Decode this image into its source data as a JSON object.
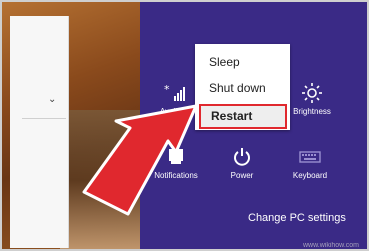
{
  "power_menu": {
    "items": [
      {
        "label": "Sleep"
      },
      {
        "label": "Shut down"
      },
      {
        "label": "Restart"
      }
    ]
  },
  "settings_tiles": [
    {
      "label": "Available",
      "icon": "network-signal-icon"
    },
    {
      "label": "Brightness",
      "icon": "brightness-icon"
    },
    {
      "label": "Notifications",
      "icon": "notifications-icon"
    },
    {
      "label": "Power",
      "icon": "power-icon"
    },
    {
      "label": "Keyboard",
      "icon": "keyboard-icon"
    }
  ],
  "footer": {
    "change_pc_settings": "Change PC settings"
  },
  "watermark": {
    "text": "www.wikihow.com"
  },
  "colors": {
    "charm_background": "#3a2a86",
    "highlight_border": "#e0282e",
    "arrow": "#e0282e"
  }
}
